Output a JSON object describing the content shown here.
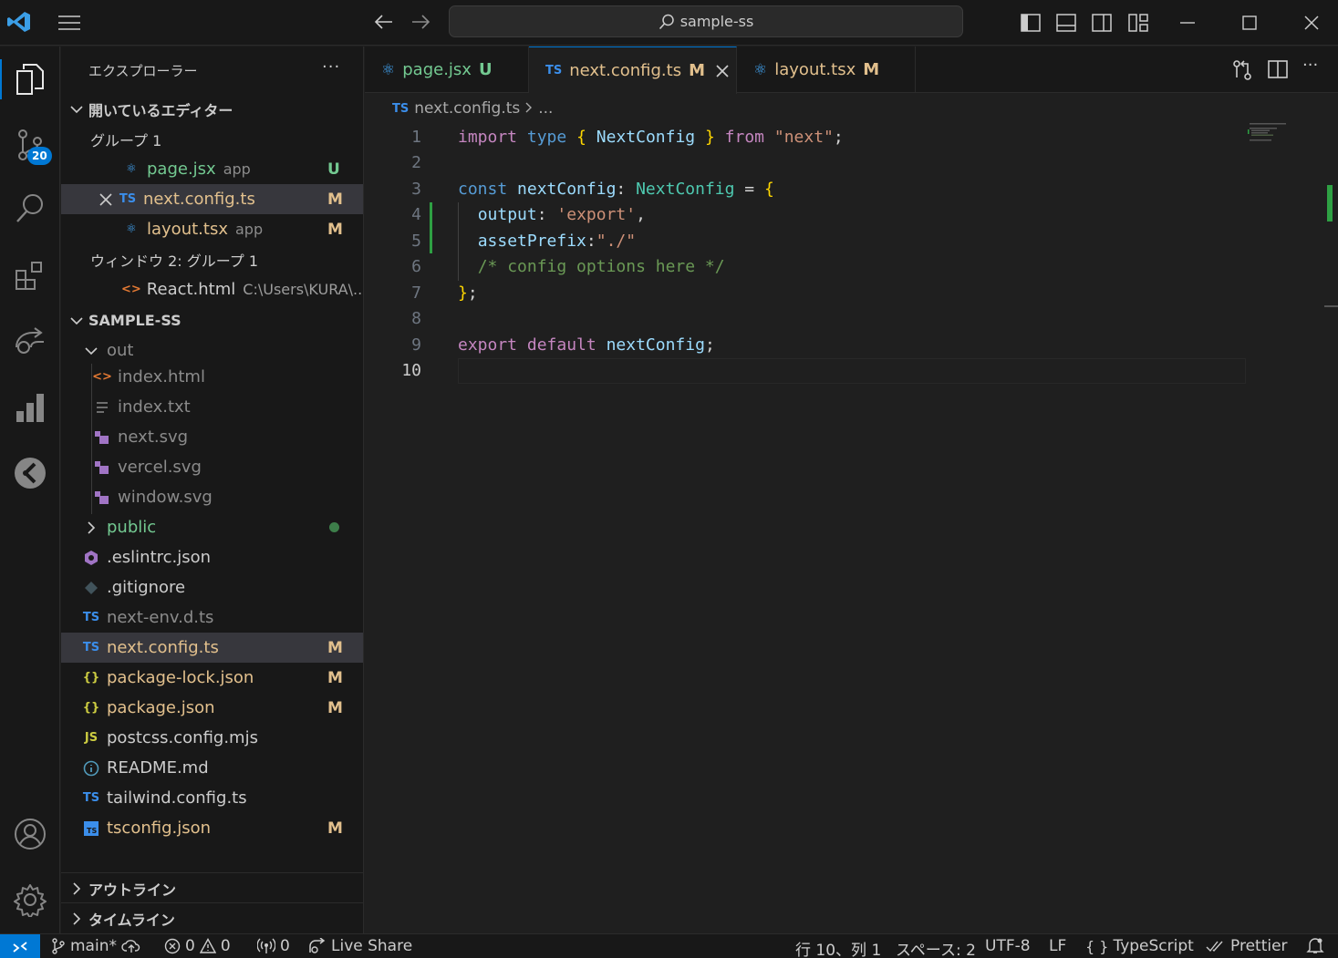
{
  "titlebar": {
    "search_text": "sample-ss"
  },
  "activity": {
    "scm_badge": "20"
  },
  "sidebar": {
    "title": "エクスプローラー",
    "more": "···",
    "open_editors": {
      "label": "開いているエディター",
      "group1": "グループ 1",
      "items": [
        {
          "name": "page.jsx",
          "hint": "app",
          "status": "U"
        },
        {
          "name": "next.config.ts",
          "hint": "",
          "status": "M"
        },
        {
          "name": "layout.tsx",
          "hint": "app",
          "status": "M"
        }
      ],
      "group2": "ウィンドウ 2: グループ 1",
      "react_item": {
        "name": "React.html",
        "hint": "C:\\Users\\KURA\\..."
      }
    },
    "project": {
      "label": "SAMPLE-SS",
      "out_folder": "out",
      "out_files": [
        "index.html",
        "index.txt",
        "next.svg",
        "vercel.svg",
        "window.svg"
      ],
      "public_folder": "public",
      "files": [
        {
          "name": ".eslintrc.json",
          "status": ""
        },
        {
          "name": ".gitignore",
          "status": ""
        },
        {
          "name": "next-env.d.ts",
          "status": ""
        },
        {
          "name": "next.config.ts",
          "status": "M"
        },
        {
          "name": "package-lock.json",
          "status": "M"
        },
        {
          "name": "package.json",
          "status": "M"
        },
        {
          "name": "postcss.config.mjs",
          "status": ""
        },
        {
          "name": "README.md",
          "status": ""
        },
        {
          "name": "tailwind.config.ts",
          "status": ""
        },
        {
          "name": "tsconfig.json",
          "status": "M"
        }
      ]
    },
    "outline": "アウトライン",
    "timeline": "タイムライン"
  },
  "tabs": [
    {
      "name": "page.jsx",
      "status": "U"
    },
    {
      "name": "next.config.ts",
      "status": "M"
    },
    {
      "name": "layout.tsx",
      "status": "M"
    }
  ],
  "editor": {
    "breadcrumb_file": "next.config.ts",
    "breadcrumb_more": "...",
    "line_numbers": [
      "1",
      "2",
      "3",
      "4",
      "5",
      "6",
      "7",
      "8",
      "9",
      "10"
    ],
    "tokens": {
      "import": "import",
      "type": "type",
      "NextConfig": "NextConfig",
      "from": "from",
      "next_str": "\"next\"",
      "const": "const",
      "nextConfig": "nextConfig",
      "output": "output",
      "export_str": "'export'",
      "assetPrefix": "assetPrefix",
      "dot_str": "\"./\"",
      "comment": "/* config options here */",
      "export": "export",
      "default": "default"
    }
  },
  "statusbar": {
    "branch": "main*",
    "errors": "0",
    "warnings": "0",
    "ports": "0",
    "live_share": "Live Share",
    "position": "行 10、列 1",
    "spaces": "スペース: 2",
    "encoding": "UTF-8",
    "eol": "LF",
    "language": "TypeScript",
    "prettier": "Prettier"
  }
}
